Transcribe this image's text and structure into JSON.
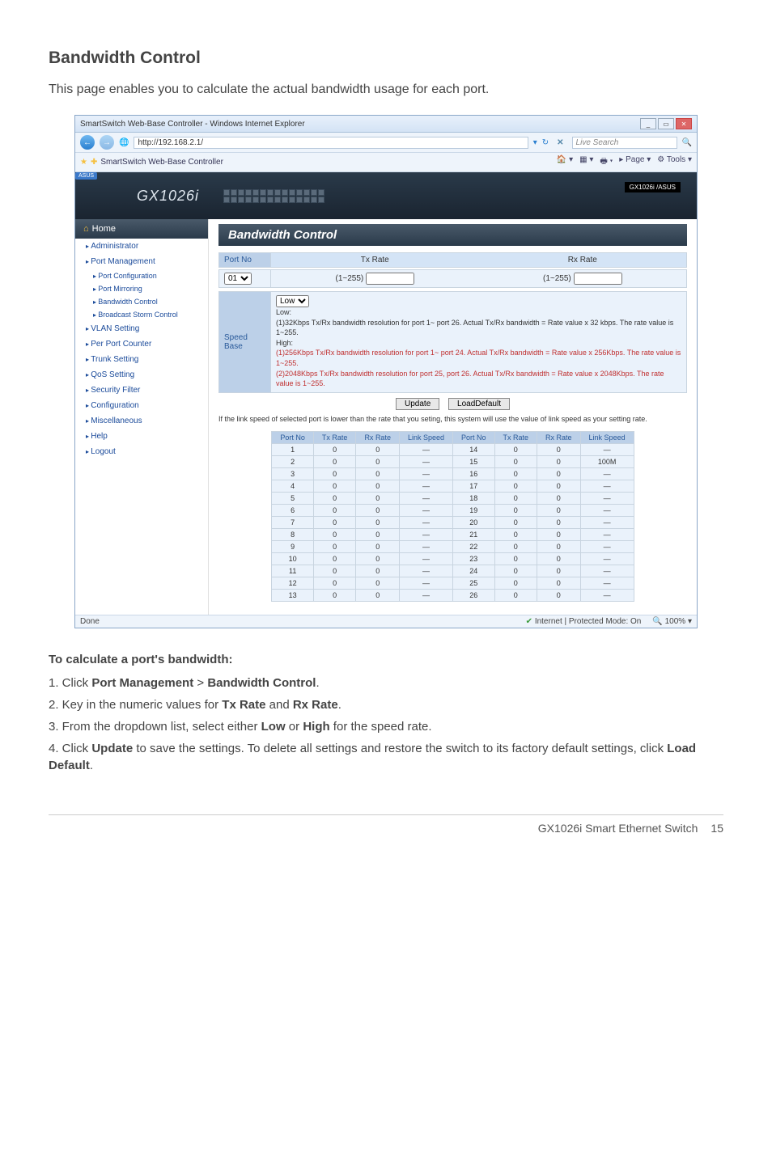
{
  "doc": {
    "heading": "Bandwidth Control",
    "intro": "This page enables you to calculate the actual bandwidth usage for each port.",
    "steps_head": "To calculate a port's bandwidth:",
    "step1_pre": "1. Click ",
    "step1_b1": "Port Management",
    "step1_mid": " > ",
    "step1_b2": "Bandwidth Control",
    "step1_end": ".",
    "step2_pre": "2. Key in the numeric values for ",
    "step2_b1": "Tx Rate",
    "step2_mid": " and ",
    "step2_b2": "Rx Rate",
    "step2_end": ".",
    "step3_pre": "3. From the dropdown list, select either ",
    "step3_b1": "Low",
    "step3_mid": " or ",
    "step3_b2": "High",
    "step3_end": " for the speed rate.",
    "step4_pre": "4. Click ",
    "step4_b1": "Update",
    "step4_mid": " to save the settings. To delete all settings and restore the switch to its factory default settings, click ",
    "step4_b2": "Load Default",
    "step4_end": ".",
    "footer_product": "GX1026i Smart Ethernet Switch",
    "footer_page": "15"
  },
  "browser": {
    "title": "SmartSwitch Web-Base Controller - Windows Internet Explorer",
    "url": "http://192.168.2.1/",
    "search_placeholder": "Live Search",
    "fav_tab": "SmartSwitch Web-Base Controller",
    "tool_page": "Page",
    "tool_tools": "Tools",
    "status_done": "Done",
    "status_mode": "Internet | Protected Mode: On",
    "status_zoom": "100%"
  },
  "banner": {
    "asus": "ASUS",
    "product": "GX1026i",
    "model_tag": "GX1026i /ASUS"
  },
  "sidebar": {
    "home": "Home",
    "items": [
      {
        "label": "Administrator"
      },
      {
        "label": "Port Management"
      },
      {
        "label": "Port Configuration",
        "sub": true
      },
      {
        "label": "Port Mirroring",
        "sub": true
      },
      {
        "label": "Bandwidth Control",
        "sub": true
      },
      {
        "label": "Broadcast Storm Control",
        "sub": true
      },
      {
        "label": "VLAN Setting"
      },
      {
        "label": "Per Port Counter"
      },
      {
        "label": "Trunk Setting"
      },
      {
        "label": "QoS Setting"
      },
      {
        "label": "Security Filter"
      },
      {
        "label": "Configuration"
      },
      {
        "label": "Miscellaneous"
      },
      {
        "label": "Help"
      },
      {
        "label": "Logout"
      }
    ]
  },
  "content": {
    "title": "Bandwidth Control",
    "hdr_portno": "Port No",
    "hdr_txrate": "Tx Rate",
    "hdr_rxrate": "Rx Rate",
    "port_selected": "01",
    "range_hint": "(1~255)",
    "speed_label": "Speed Base",
    "speed_selected": "Low",
    "speed_low_h": "Low:",
    "speed_low_t": "(1)32Kbps Tx/Rx bandwidth resolution for port 1~ port 26. Actual Tx/Rx bandwidth = Rate value x 32 kbps. The rate value is 1~255.",
    "speed_high_h": "High:",
    "speed_high_t1": "(1)256Kbps Tx/Rx bandwidth resolution for port 1~ port 24. Actual Tx/Rx bandwidth = Rate value x 256Kbps. The rate value is 1~255.",
    "speed_high_t2": "(2)2048Kbps Tx/Rx bandwidth resolution for port 25, port 26. Actual Tx/Rx bandwidth = Rate value x 2048Kbps. The rate value is 1~255.",
    "btn_update": "Update",
    "btn_load": "LoadDefault",
    "note": "If the link speed of selected port is lower than the rate that you seting, this system will use the value of link speed as your setting rate.",
    "tbl_headers": [
      "Port No",
      "Tx Rate",
      "Rx Rate",
      "Link Speed",
      "Port No",
      "Tx Rate",
      "Rx Rate",
      "Link Speed"
    ],
    "rows": [
      [
        "1",
        "0",
        "0",
        "—",
        "14",
        "0",
        "0",
        "—"
      ],
      [
        "2",
        "0",
        "0",
        "—",
        "15",
        "0",
        "0",
        "100M"
      ],
      [
        "3",
        "0",
        "0",
        "—",
        "16",
        "0",
        "0",
        "—"
      ],
      [
        "4",
        "0",
        "0",
        "—",
        "17",
        "0",
        "0",
        "—"
      ],
      [
        "5",
        "0",
        "0",
        "—",
        "18",
        "0",
        "0",
        "—"
      ],
      [
        "6",
        "0",
        "0",
        "—",
        "19",
        "0",
        "0",
        "—"
      ],
      [
        "7",
        "0",
        "0",
        "—",
        "20",
        "0",
        "0",
        "—"
      ],
      [
        "8",
        "0",
        "0",
        "—",
        "21",
        "0",
        "0",
        "—"
      ],
      [
        "9",
        "0",
        "0",
        "—",
        "22",
        "0",
        "0",
        "—"
      ],
      [
        "10",
        "0",
        "0",
        "—",
        "23",
        "0",
        "0",
        "—"
      ],
      [
        "11",
        "0",
        "0",
        "—",
        "24",
        "0",
        "0",
        "—"
      ],
      [
        "12",
        "0",
        "0",
        "—",
        "25",
        "0",
        "0",
        "—"
      ],
      [
        "13",
        "0",
        "0",
        "—",
        "26",
        "0",
        "0",
        "—"
      ]
    ]
  }
}
